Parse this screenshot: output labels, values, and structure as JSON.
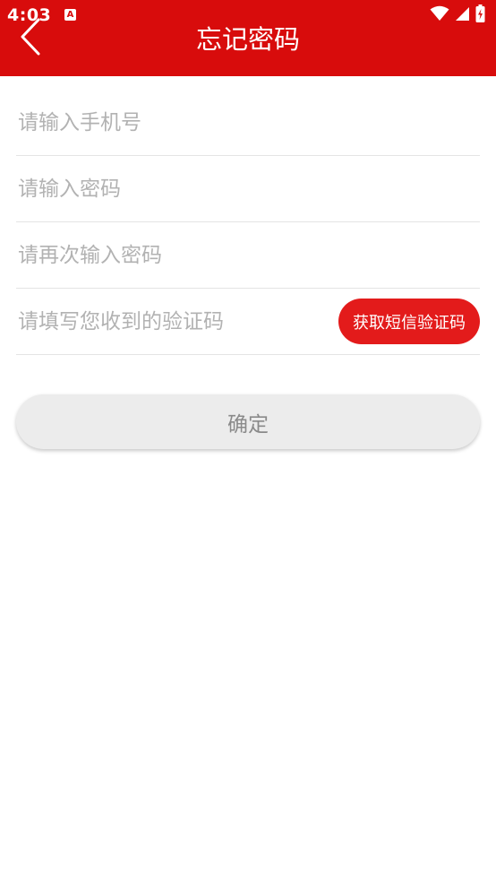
{
  "status_bar": {
    "time": "4:03",
    "app_icon_glyph": "A",
    "icons": [
      "wifi-icon",
      "cell-signal-icon",
      "battery-charging-icon"
    ]
  },
  "app_bar": {
    "title": "忘记密码",
    "background_color": "#d80c0c",
    "back_icon": "chevron-left-icon"
  },
  "form": {
    "phone_placeholder": "请输入手机号",
    "password_placeholder": "请输入密码",
    "password_confirm_placeholder": "请再次输入密码",
    "code_placeholder": "请填写您收到的验证码",
    "sms_button_label": "获取短信验证码",
    "sms_button_color": "#e31b1b"
  },
  "confirm_button_label": "确定"
}
